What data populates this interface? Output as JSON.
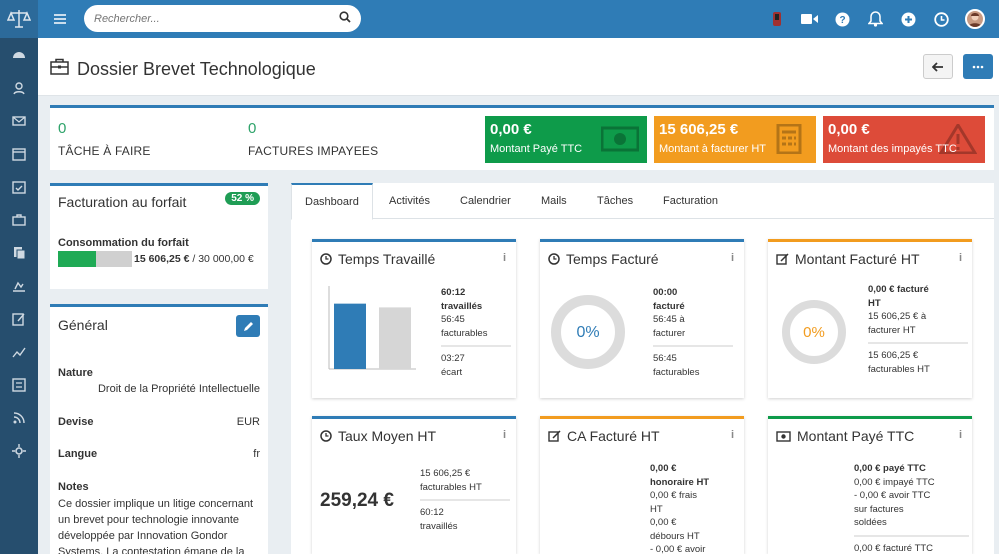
{
  "search": {
    "placeholder": "Rechercher..."
  },
  "page": {
    "title": "Dossier Brevet Technologique"
  },
  "stats": {
    "taches_count": "0",
    "taches_label": "TÂCHE À FAIRE",
    "factures_count": "0",
    "factures_label": "FACTURES IMPAYEES"
  },
  "kpis": [
    {
      "value": "0,00 €",
      "label": "Montant Payé TTC",
      "color": "#0e9b4a",
      "icon": "money-icon"
    },
    {
      "value": "15 606,25 €",
      "label": "Montant à facturer HT",
      "color": "#f29c1f",
      "icon": "calculator-icon"
    },
    {
      "value": "0,00 €",
      "label": "Montant des impayés TTC",
      "color": "#dd4b39",
      "icon": "warning-icon"
    }
  ],
  "forfait": {
    "title": "Facturation au forfait",
    "badge": "52 %",
    "label": "Consommation du forfait",
    "amount": "15 606,25 €",
    "total": " / 30 000,00 €",
    "progress": 0.52
  },
  "general": {
    "title": "Général",
    "nature_label": "Nature",
    "nature_value": "Droit de la Propriété Intellectuelle",
    "devise_label": "Devise",
    "devise_value": "EUR",
    "langue_label": "Langue",
    "langue_value": "fr",
    "notes_label": "Notes",
    "notes_text": "Ce dossier implique un litige concernant un brevet pour technologie innovante développée par Innovation Gondor Systems. La contestation émane de la"
  },
  "tabs": [
    "Dashboard",
    "Activités",
    "Calendrier",
    "Mails",
    "Tâches",
    "Facturation"
  ],
  "cards": {
    "temps_travaille": {
      "title": "Temps Travaillé",
      "l1": "60:12",
      "l2": "travaillés",
      "l3": "56:45",
      "l4": "facturables",
      "l5": "03:27",
      "l6": "écart"
    },
    "temps_facture": {
      "title": "Temps Facturé",
      "pct": "0%",
      "l1": "00:00",
      "l2": "facturé",
      "l3": "56:45 à",
      "l4": "facturer",
      "l5": "56:45",
      "l6": "facturables"
    },
    "montant_facture": {
      "title": "Montant Facturé HT",
      "pct": "0%",
      "l1": "0,00 € facturé",
      "l2": "HT",
      "l3": "15 606,25 € à",
      "l4": "facturer HT",
      "l5": "15 606,25 €",
      "l6": "facturables HT"
    },
    "taux_moyen": {
      "title": "Taux Moyen HT",
      "big": "259,24 €",
      "l1": "15 606,25 €",
      "l2": "facturables HT",
      "l3": "60:12",
      "l4": "travaillés"
    },
    "ca_facture": {
      "title": "CA Facturé HT",
      "l1": "0,00 €",
      "l2": "honoraire HT",
      "l3": "0,00 € frais",
      "l4": "HT",
      "l5": "0,00 €",
      "l6": "débours HT",
      "l7": "- 0,00 € avoir"
    },
    "montant_paye": {
      "title": "Montant Payé TTC",
      "l1": "0,00 € payé TTC",
      "l2": "0,00 € impayé TTC",
      "l3": "- 0,00 € avoir TTC",
      "l4": "sur factures",
      "l5": "soldées",
      "l6": "0,00 € facturé TTC"
    }
  },
  "chart_data": {
    "type": "bar",
    "categories": [
      "travaillés",
      "facturables"
    ],
    "values": [
      60.2,
      56.75
    ],
    "ylim": [
      0,
      70
    ]
  },
  "colors": {
    "primary": "#2f7cb6",
    "green": "#0e9b4a",
    "orange": "#f29c1f",
    "red": "#dd4b39",
    "bar_blue": "#2f7cb6",
    "bar_grey": "#d6d6d6"
  }
}
